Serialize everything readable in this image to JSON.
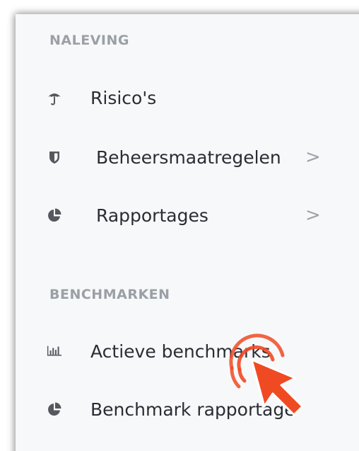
{
  "sections": [
    {
      "title": "NALEVING",
      "items": [
        {
          "label": "Risico's",
          "icon": "umbrella-icon",
          "chevron": ""
        },
        {
          "label": "Beheersmaatregelen",
          "icon": "shield-icon",
          "chevron": ">"
        },
        {
          "label": "Rapportages",
          "icon": "pie-chart-icon",
          "chevron": ">"
        }
      ]
    },
    {
      "title": "BENCHMARKEN",
      "items": [
        {
          "label": "Actieve benchmarks",
          "icon": "bar-chart-icon",
          "chevron": ""
        },
        {
          "label": "Benchmark rapportage",
          "icon": "pie-chart-icon",
          "chevron": ""
        }
      ]
    }
  ],
  "colors": {
    "panel_background": "#f7f8fa",
    "section_title": "#9aa0a6",
    "item_text": "#2a2d33",
    "cursor_accent": "#f04a23"
  },
  "cursor": {
    "icon": "click-cursor-icon"
  }
}
